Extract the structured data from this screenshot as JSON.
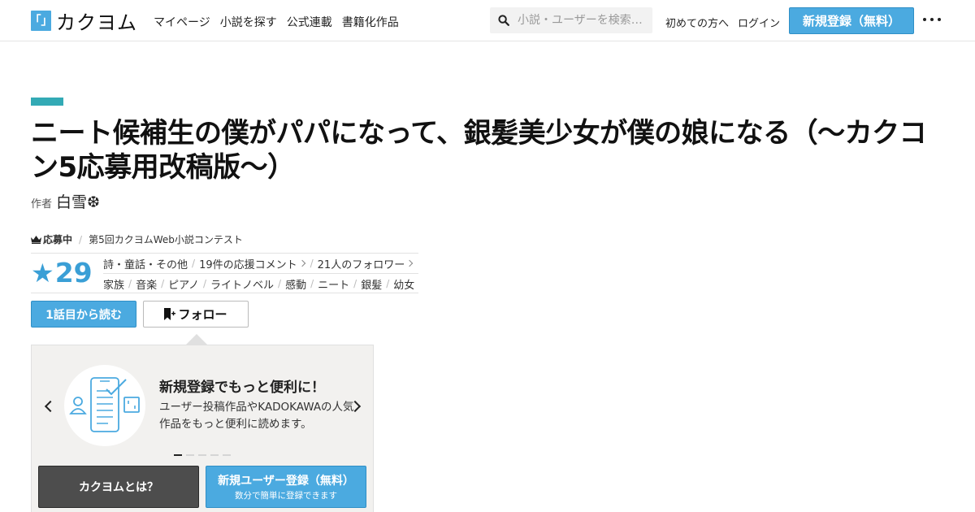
{
  "header": {
    "logo_mark": "「」",
    "logo_text": "カクヨム",
    "nav": [
      "マイページ",
      "小説を探す",
      "公式連載",
      "書籍化作品"
    ],
    "search_placeholder": "小説・ユーザーを検索…",
    "beginner_link": "初めての方へ",
    "login_link": "ログイン",
    "register_button": "新規登録（無料）"
  },
  "work": {
    "title": "ニート候補生の僕がパパになって、銀髪美少女が僕の娘になる（～カクコン5応募用改稿版～）",
    "author_label": "作者",
    "author_name": "白雪❆"
  },
  "contest": {
    "badge": "応募中",
    "name": "第5回カクヨムWeb小説コンテスト"
  },
  "stats": {
    "star_glyph": "★",
    "stars": "29",
    "genre": "詩・童話・その他",
    "comments": "19件の応援コメント",
    "followers": "21人のフォロワー",
    "tags": [
      "家族",
      "音楽",
      "ピアノ",
      "ライトノベル",
      "感動",
      "ニート",
      "銀髪",
      "幼女"
    ]
  },
  "actions": {
    "read_first": "1話目から読む",
    "follow": "フォロー"
  },
  "promo": {
    "heading": "新規登録でもっと便利に！",
    "body": "ユーザー投稿作品やKADOKAWAの人気作品をもっと便利に読めます。",
    "about_button": "カクヨムとは？",
    "signup_button": "新規ユーザー登録（無料）",
    "signup_sub": "数分で簡単に登録できます",
    "slide_count": 5,
    "active_slide": 1
  },
  "colors": {
    "accent_blue": "#4baae0",
    "star_blue": "#3a9fd6",
    "teal_bar": "#33aab5",
    "dark_button": "#4d4d4d"
  }
}
